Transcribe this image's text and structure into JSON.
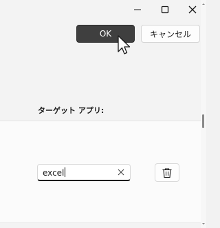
{
  "window": {
    "caption_buttons": {
      "minimize": "minimize-icon",
      "maximize": "maximize-icon",
      "close": "close-icon"
    }
  },
  "dialog": {
    "ok_label": "OK",
    "cancel_label": "キャンセル"
  },
  "target": {
    "label": "ターゲット アプリ:",
    "app_value": "excel",
    "clear_icon": "clear-x-icon",
    "delete_icon": "trash-icon"
  },
  "colors": {
    "ok_bg": "#3f3f3f",
    "panel_bg": "#fbfbfb",
    "window_bg": "#f3f3f3"
  }
}
